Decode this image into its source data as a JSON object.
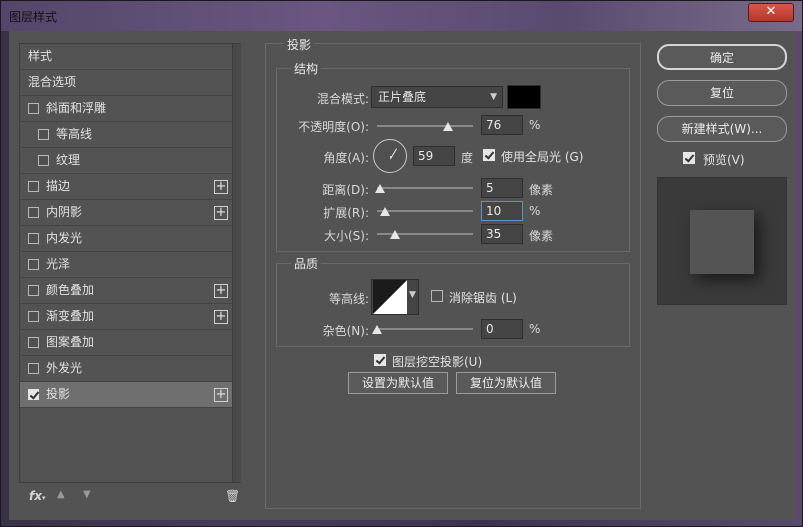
{
  "window": {
    "title": "图层样式",
    "close_label": "✕"
  },
  "left_panel": {
    "items": [
      {
        "label": "样式",
        "checkbox": false,
        "checked": false,
        "plus": false,
        "indent": 0,
        "selected": false
      },
      {
        "label": "混合选项",
        "checkbox": false,
        "checked": false,
        "plus": false,
        "indent": 0,
        "selected": false
      },
      {
        "label": "斜面和浮雕",
        "checkbox": true,
        "checked": false,
        "plus": false,
        "indent": 0,
        "selected": false
      },
      {
        "label": "等高线",
        "checkbox": true,
        "checked": false,
        "plus": false,
        "indent": 1,
        "selected": false
      },
      {
        "label": "纹理",
        "checkbox": true,
        "checked": false,
        "plus": false,
        "indent": 1,
        "selected": false
      },
      {
        "label": "描边",
        "checkbox": true,
        "checked": false,
        "plus": true,
        "indent": 0,
        "selected": false
      },
      {
        "label": "内阴影",
        "checkbox": true,
        "checked": false,
        "plus": true,
        "indent": 0,
        "selected": false
      },
      {
        "label": "内发光",
        "checkbox": true,
        "checked": false,
        "plus": false,
        "indent": 0,
        "selected": false
      },
      {
        "label": "光泽",
        "checkbox": true,
        "checked": false,
        "plus": false,
        "indent": 0,
        "selected": false
      },
      {
        "label": "颜色叠加",
        "checkbox": true,
        "checked": false,
        "plus": true,
        "indent": 0,
        "selected": false
      },
      {
        "label": "渐变叠加",
        "checkbox": true,
        "checked": false,
        "plus": true,
        "indent": 0,
        "selected": false
      },
      {
        "label": "图案叠加",
        "checkbox": true,
        "checked": false,
        "plus": false,
        "indent": 0,
        "selected": false
      },
      {
        "label": "外发光",
        "checkbox": true,
        "checked": false,
        "plus": false,
        "indent": 0,
        "selected": false
      },
      {
        "label": "投影",
        "checkbox": true,
        "checked": true,
        "plus": true,
        "indent": 0,
        "selected": true
      }
    ],
    "footer": {
      "fx_label": "fx",
      "fx_sub": "▾",
      "up_icon": "▲",
      "down_icon": "▼",
      "trash_icon": "🗑"
    }
  },
  "drop_shadow": {
    "section_title": "投影",
    "structure": {
      "title": "结构",
      "blend_mode_label": "混合模式:",
      "blend_mode_value": "正片叠底",
      "blend_color": "#000000",
      "opacity_label": "不透明度(O):",
      "opacity_value": "76",
      "opacity_unit": "%",
      "angle_label": "角度(A):",
      "angle_value": "59",
      "angle_unit": "度",
      "global_light_label": "使用全局光 (G)",
      "global_light_checked": true,
      "distance_label": "距离(D):",
      "distance_value": "5",
      "distance_unit": "像素",
      "spread_label": "扩展(R):",
      "spread_value": "10",
      "spread_unit": "%",
      "size_label": "大小(S):",
      "size_value": "35",
      "size_unit": "像素"
    },
    "quality": {
      "title": "品质",
      "contour_label": "等高线:",
      "antialias_label": "消除锯齿 (L)",
      "antialias_checked": false,
      "noise_label": "杂色(N):",
      "noise_value": "0",
      "noise_unit": "%"
    },
    "knockout_label": "图层挖空投影(U)",
    "knockout_checked": true,
    "set_default_label": "设置为默认值",
    "reset_default_label": "复位为默认值"
  },
  "right_panel": {
    "ok_label": "确定",
    "reset_label": "复位",
    "new_style_label": "新建样式(W)...",
    "preview_label": "预览(V)",
    "preview_checked": true
  }
}
